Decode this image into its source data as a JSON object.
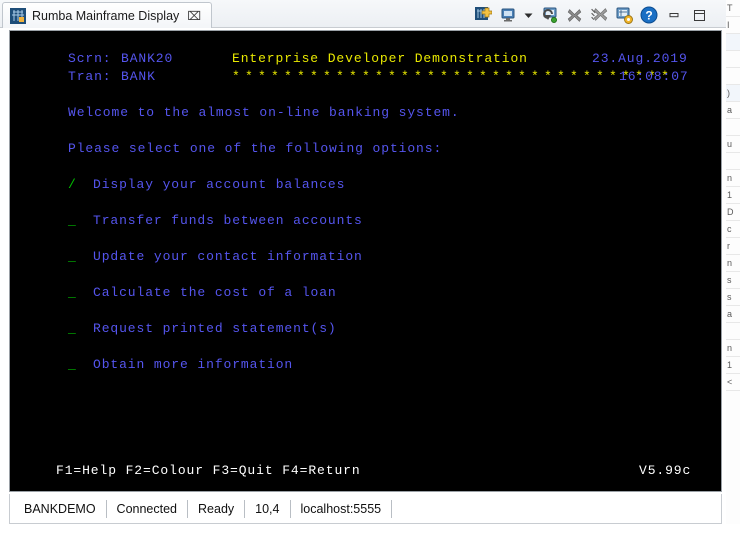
{
  "window": {
    "tab_title": "Rumba Mainframe Display",
    "tab_icon": "mainframe-icon",
    "close_glyph": "⌧"
  },
  "toolbar": {
    "items": [
      {
        "name": "new-session-icon",
        "title": "New Session"
      },
      {
        "name": "display-icon",
        "title": "Display"
      },
      {
        "name": "dropdown-arrow-icon",
        "title": "More"
      },
      {
        "name": "reconnect-icon",
        "title": "Reconnect"
      },
      {
        "name": "disconnect-icon",
        "title": "Disconnect"
      },
      {
        "name": "disconnect-all-icon",
        "title": "Disconnect All"
      },
      {
        "name": "session-settings-icon",
        "title": "Session Settings"
      },
      {
        "name": "help-icon",
        "title": "Help"
      },
      {
        "name": "minimize-icon",
        "title": "Minimize"
      },
      {
        "name": "restore-icon",
        "title": "Restore"
      }
    ]
  },
  "terminal": {
    "screen_label": "Scrn:",
    "screen_value": "BANK20",
    "tran_label": "Tran:",
    "tran_value": "BANK",
    "title": "Enterprise Developer Demonstration",
    "title_rule": "**********************************",
    "date": "23.Aug.2019",
    "time": "16:08:07",
    "welcome": "Welcome to the almost on-line banking system.",
    "prompt": "Please select one of the following options:",
    "options": [
      {
        "marker": "/",
        "label": "Display your account balances"
      },
      {
        "marker": "_",
        "label": "Transfer funds between accounts"
      },
      {
        "marker": "_",
        "label": "Update your contact information"
      },
      {
        "marker": "_",
        "label": "Calculate the cost of a loan"
      },
      {
        "marker": "_",
        "label": "Request printed statement(s)"
      },
      {
        "marker": "_",
        "label": "Obtain more information"
      }
    ],
    "function_keys": "F1=Help F2=Colour F3=Quit F4=Return",
    "version": "V5.99c",
    "colors": {
      "background": "#000000",
      "label_blue": "#5555ee",
      "title_yellow": "#e8e800",
      "marker_green": "#00c000",
      "fkey_white": "#ffffff"
    }
  },
  "statusbar": {
    "session": "BANKDEMO",
    "connection": "Connected",
    "state": "Ready",
    "cursor": "10,4",
    "host": "localhost:5555"
  },
  "background_rows": [
    "T",
    "I",
    "",
    "",
    "",
    ")",
    "a",
    "",
    "u",
    "",
    "n",
    "1",
    "D",
    "c",
    "r",
    "n",
    "s",
    "s",
    "a",
    "",
    "n",
    "1",
    "<"
  ]
}
